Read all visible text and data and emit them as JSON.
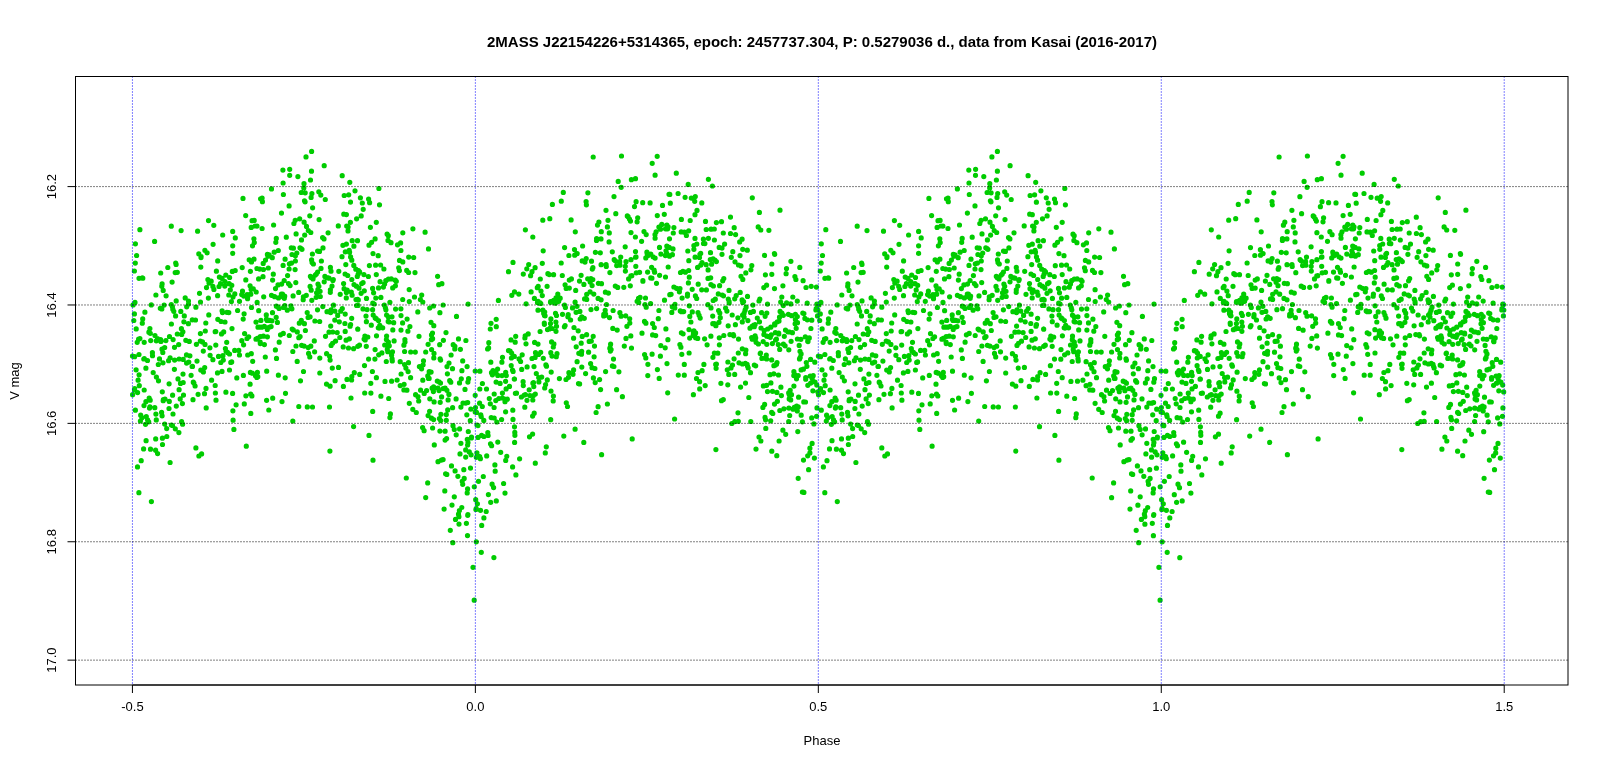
{
  "chart": {
    "chart_data": {
      "type": "scatter",
      "title": "2MASS J22154226+5314365, epoch: 2457737.304, P: 0.5279036 d., data from Kasai (2016-2017)",
      "xlabel": "Phase",
      "ylabel": "V mag",
      "xlim": [
        -0.583,
        1.593
      ],
      "ylim": [
        17.042,
        16.014
      ],
      "grid": true,
      "ref_lines": [
        {
          "axis": "x",
          "value": -0.5,
          "color": "#0000ff"
        },
        {
          "axis": "x",
          "value": 0,
          "color": "#0000ff"
        },
        {
          "axis": "x",
          "value": 0.5,
          "color": "#0000ff"
        },
        {
          "axis": "x",
          "value": 1,
          "color": "#0000ff"
        },
        {
          "axis": "x",
          "value": 1.5,
          "color": "#0000ff"
        }
      ],
      "xticks": [
        {
          "value": -0.5,
          "label": "-0.5"
        },
        {
          "value": 0,
          "label": "0.0"
        },
        {
          "value": 0.5,
          "label": "0.5"
        },
        {
          "value": 1,
          "label": "1.0"
        },
        {
          "value": 1.5,
          "label": "1.5"
        }
      ],
      "yticks": [
        {
          "value": 16.2,
          "label": "16.2"
        },
        {
          "value": 16.4,
          "label": "16.4"
        },
        {
          "value": 16.6,
          "label": "16.6"
        },
        {
          "value": 16.8,
          "label": "16.8"
        },
        {
          "value": 17,
          "label": "17.0"
        }
      ]
    }
  }
}
